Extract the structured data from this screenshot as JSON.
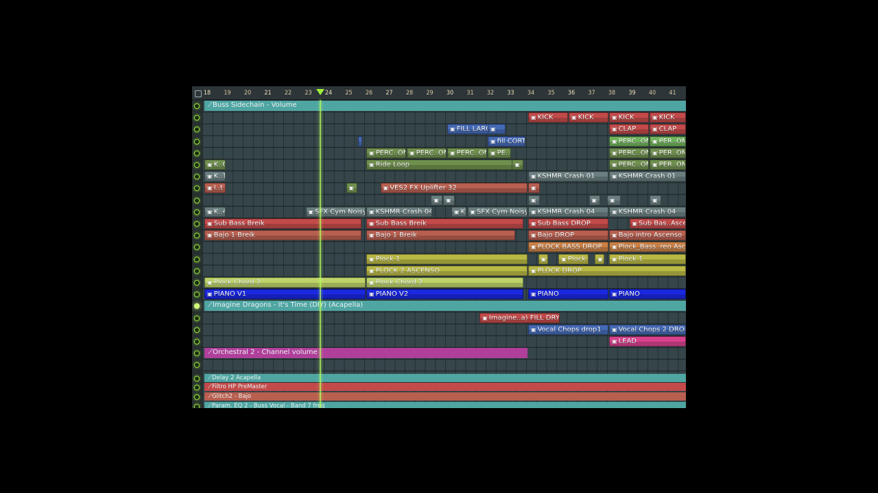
{
  "colors": {
    "teal": "#4fa5a2",
    "red": "#c24a4a",
    "blue": "#4469b5",
    "green": "#70b35a",
    "olive": "#6f8f4e",
    "salmon": "#b85f50",
    "orange": "#c97f45",
    "yellow": "#b8b845",
    "lime": "#bdd36a",
    "pianoBlue": "#1a28e0",
    "magenta": "#b03f9b",
    "pink": "#d6428e",
    "grayish": "#6a7e80"
  },
  "ruler": {
    "ticks": [
      "18",
      "19",
      "20",
      "21",
      "22",
      "23",
      "24",
      "25",
      "26",
      "27",
      "28",
      "29",
      "30",
      "31",
      "32",
      "33",
      "34",
      "35",
      "36",
      "37",
      "38",
      "39",
      "40",
      "41"
    ],
    "playhead_bar": "23.6"
  },
  "tracks": [
    {
      "name": "Buss Sidechain - Volume",
      "auto": true,
      "clips": [
        {
          "label": "Buss Sidechain - Volume",
          "start": 18,
          "end": 42,
          "color": "teal"
        }
      ]
    },
    {
      "clips": [
        {
          "label": "KICK",
          "start": 34,
          "end": 36,
          "color": "red"
        },
        {
          "label": "KICK",
          "start": 36,
          "end": 38,
          "color": "red"
        },
        {
          "label": "KICK",
          "start": 38,
          "end": 40,
          "color": "red"
        },
        {
          "label": "KICK",
          "start": 40,
          "end": 42,
          "color": "red"
        }
      ]
    },
    {
      "clips": [
        {
          "label": "FILL LARGO",
          "start": 30,
          "end": 32.1,
          "color": "blue"
        },
        {
          "label": "",
          "start": 32,
          "end": 32.9,
          "color": "blue"
        },
        {
          "label": "CLAP",
          "start": 38,
          "end": 40,
          "color": "red"
        },
        {
          "label": "CLAP",
          "start": 40,
          "end": 42,
          "color": "red"
        }
      ]
    },
    {
      "clips": [
        {
          "label": "",
          "start": 25.6,
          "end": 25.8,
          "color": "blue"
        },
        {
          "label": "fill CORT",
          "start": 32,
          "end": 33.9,
          "color": "blue"
        },
        {
          "label": "PERC..ON 2",
          "start": 38,
          "end": 40,
          "color": "green"
        },
        {
          "label": "PER..ON 2",
          "start": 40,
          "end": 42,
          "color": "green"
        }
      ]
    },
    {
      "clips": [
        {
          "label": "PERC..ON 1",
          "start": 26,
          "end": 28,
          "color": "olive"
        },
        {
          "label": "PERC..ON 1",
          "start": 28,
          "end": 30,
          "color": "olive"
        },
        {
          "label": "PERC..ON 1",
          "start": 30,
          "end": 32,
          "color": "olive"
        },
        {
          "label": "PE..1",
          "start": 32,
          "end": 33.2,
          "color": "olive"
        },
        {
          "label": "PERC..ON 1",
          "start": 38,
          "end": 40,
          "color": "olive"
        },
        {
          "label": "PER..ON 1",
          "start": 40,
          "end": 42,
          "color": "olive"
        }
      ]
    },
    {
      "clips": [
        {
          "label": "K..0",
          "start": 18,
          "end": 19.1,
          "color": "olive"
        },
        {
          "label": "Ride Loop",
          "start": 26,
          "end": 33.3,
          "color": "olive"
        },
        {
          "label": "",
          "start": 33.2,
          "end": 33.8,
          "color": "olive"
        },
        {
          "label": "PERC..ON 3",
          "start": 38,
          "end": 40,
          "color": "olive"
        },
        {
          "label": "PER..ON 3",
          "start": 40,
          "end": 42,
          "color": "olive"
        }
      ]
    },
    {
      "clips": [
        {
          "label": "K..1",
          "start": 18,
          "end": 19.1,
          "color": "grayish"
        },
        {
          "label": "KSHMR Crash 01",
          "start": 34,
          "end": 38,
          "color": "grayish"
        },
        {
          "label": "KSHMR Crash 01",
          "start": 38,
          "end": 42,
          "color": "grayish"
        }
      ]
    },
    {
      "clips": [
        {
          "label": "I..t",
          "start": 18,
          "end": 19.1,
          "color": "salmon"
        },
        {
          "label": "",
          "start": 25,
          "end": 25.6,
          "color": "olive"
        },
        {
          "label": "VES2 FX Uplifter 32",
          "start": 26.7,
          "end": 34,
          "color": "salmon"
        },
        {
          "label": "",
          "start": 34,
          "end": 34.6,
          "color": "salmon"
        }
      ]
    },
    {
      "clips": [
        {
          "label": "",
          "start": 29.2,
          "end": 29.8,
          "color": "grayish"
        },
        {
          "label": "",
          "start": 29.8,
          "end": 30.4,
          "color": "grayish"
        },
        {
          "label": "",
          "start": 34,
          "end": 34.6,
          "color": "grayish"
        },
        {
          "label": "",
          "start": 37,
          "end": 37.6,
          "color": "grayish"
        },
        {
          "label": "",
          "start": 37.9,
          "end": 38.6,
          "color": "grayish"
        },
        {
          "label": "",
          "start": 40,
          "end": 40.6,
          "color": "grayish"
        }
      ]
    },
    {
      "clips": [
        {
          "label": "K..4",
          "start": 18,
          "end": 19.1,
          "color": "grayish"
        },
        {
          "label": "SFX Cym Noisy #2",
          "start": 23,
          "end": 26,
          "color": "grayish"
        },
        {
          "label": "KSHMR Crash 04",
          "start": 26,
          "end": 29.3,
          "color": "grayish"
        },
        {
          "label": "KS",
          "start": 30.2,
          "end": 31,
          "color": "grayish"
        },
        {
          "label": "SFX Cym Noisy #2",
          "start": 31,
          "end": 34,
          "color": "grayish"
        },
        {
          "label": "KSHMR Crash 04",
          "start": 34,
          "end": 38,
          "color": "grayish"
        },
        {
          "label": "KSHMR Crash 04",
          "start": 38,
          "end": 42,
          "color": "grayish"
        }
      ]
    },
    {
      "clips": [
        {
          "label": "Sub Bass Breik",
          "start": 18,
          "end": 25.8,
          "color": "red"
        },
        {
          "label": "Sub Bass Breik",
          "start": 26,
          "end": 33.8,
          "color": "red"
        },
        {
          "label": "Sub Bass DROP",
          "start": 34,
          "end": 38,
          "color": "red"
        },
        {
          "label": "Sub Bas..Ascenso",
          "start": 39,
          "end": 42,
          "color": "red"
        }
      ]
    },
    {
      "clips": [
        {
          "label": "Bajo 1 Breik",
          "start": 18,
          "end": 25.8,
          "color": "salmon"
        },
        {
          "label": "Bajo 1 Breik",
          "start": 26,
          "end": 33.4,
          "color": "salmon"
        },
        {
          "label": "Bajo DROP",
          "start": 34,
          "end": 38,
          "color": "salmon"
        },
        {
          "label": "Bajo intro Ascenso",
          "start": 38,
          "end": 42,
          "color": "salmon"
        }
      ]
    },
    {
      "clips": [
        {
          "label": "PLOCK BASS DROP",
          "start": 34,
          "end": 38,
          "color": "orange"
        },
        {
          "label": "Plock_Bass..reo Ascenso",
          "start": 38,
          "end": 42,
          "color": "orange"
        }
      ]
    },
    {
      "clips": [
        {
          "label": "Plock 1",
          "start": 26,
          "end": 34,
          "color": "yellow"
        },
        {
          "label": "",
          "start": 34.5,
          "end": 35,
          "color": "yellow"
        },
        {
          "label": "Plock 1",
          "start": 35.5,
          "end": 37,
          "color": "yellow"
        },
        {
          "label": "",
          "start": 37.3,
          "end": 37.8,
          "color": "yellow"
        },
        {
          "label": "Plock 1",
          "start": 38,
          "end": 42,
          "color": "yellow"
        }
      ]
    },
    {
      "clips": [
        {
          "label": "PLOCK 2 ASCENSO",
          "start": 26,
          "end": 34,
          "color": "yellow"
        },
        {
          "label": "PLOCK DROP",
          "start": 34,
          "end": 42,
          "color": "yellow"
        }
      ]
    },
    {
      "clips": [
        {
          "label": "Plock Chord 2",
          "start": 18,
          "end": 26,
          "color": "lime"
        },
        {
          "label": "Plock Chord 2",
          "start": 26,
          "end": 33.8,
          "color": "lime"
        }
      ]
    },
    {
      "clips": [
        {
          "label": "PIANO V1",
          "start": 18,
          "end": 26,
          "color": "pianoBlue"
        },
        {
          "label": "PIANO V2",
          "start": 26,
          "end": 33.8,
          "color": "pianoBlue"
        },
        {
          "label": "PIANO",
          "start": 34,
          "end": 38,
          "color": "pianoBlue"
        },
        {
          "label": "PIANO",
          "start": 38,
          "end": 42,
          "color": "pianoBlue"
        }
      ]
    },
    {
      "auto": true,
      "active": true,
      "clips": [
        {
          "label": "Imagine Dragons -  It's Time (DIY) (Acapella)",
          "start": 18,
          "end": 42,
          "color": "teal"
        }
      ]
    },
    {
      "clips": [
        {
          "label": "Imagine..a) FILL DRY",
          "start": 31.6,
          "end": 35.6,
          "color": "red"
        }
      ]
    },
    {
      "clips": [
        {
          "label": "Vocal Chops drop1",
          "start": 34,
          "end": 38,
          "color": "blue"
        },
        {
          "label": "Vocal Chops 2 DROP",
          "start": 38,
          "end": 42,
          "color": "blue"
        }
      ]
    },
    {
      "clips": [
        {
          "label": "LEAD",
          "start": 38,
          "end": 42,
          "color": "pink"
        }
      ]
    },
    {
      "auto": true,
      "clips": [
        {
          "label": "Orchestral 2 - Channel volume",
          "start": 18,
          "end": 34,
          "color": "magenta"
        }
      ]
    },
    {
      "clips": []
    }
  ],
  "automation_lanes": [
    {
      "label": "Delay 2 Acapella",
      "color": "teal"
    },
    {
      "label": "Filtro HP PreMaster",
      "color": "red"
    },
    {
      "label": "Glitch2 - Bajo",
      "color": "salmon"
    },
    {
      "label": "Param. EQ 2 - Buss Vocal - Band 7 freq",
      "color": "teal"
    }
  ]
}
